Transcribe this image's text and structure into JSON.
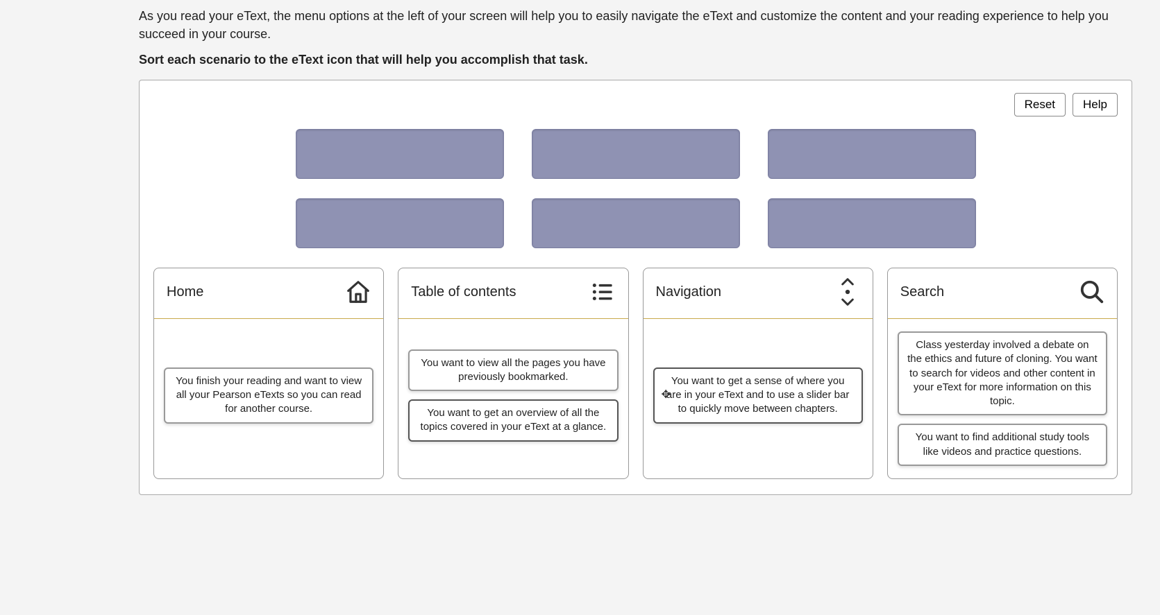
{
  "intro": "As you read your eText, the menu options at the left of your screen will help you to easily navigate the eText and customize the content and your reading experience to help you succeed in your course.",
  "prompt": "Sort each scenario to the eText icon that will help you accomplish that task.",
  "buttons": {
    "reset": "Reset",
    "help": "Help"
  },
  "categories": {
    "home": {
      "title": "Home",
      "cards": [
        "You finish your reading and want to view all your Pearson eTexts so you can read for another course."
      ]
    },
    "toc": {
      "title": "Table of contents",
      "cards": [
        "You want to view all the pages you have previously bookmarked.",
        "You want to get an overview of all the topics covered in your eText at a glance."
      ]
    },
    "nav": {
      "title": "Navigation",
      "cards": [
        "You want to get a sense of where you are in your eText and to use a slider bar to quickly move between chapters."
      ]
    },
    "search": {
      "title": "Search",
      "cards": [
        "Class yesterday involved a debate on the ethics and future of cloning. You want to search for videos and other content in your eText for more information on this topic.",
        "You want to find additional study tools like videos and practice questions."
      ]
    }
  }
}
